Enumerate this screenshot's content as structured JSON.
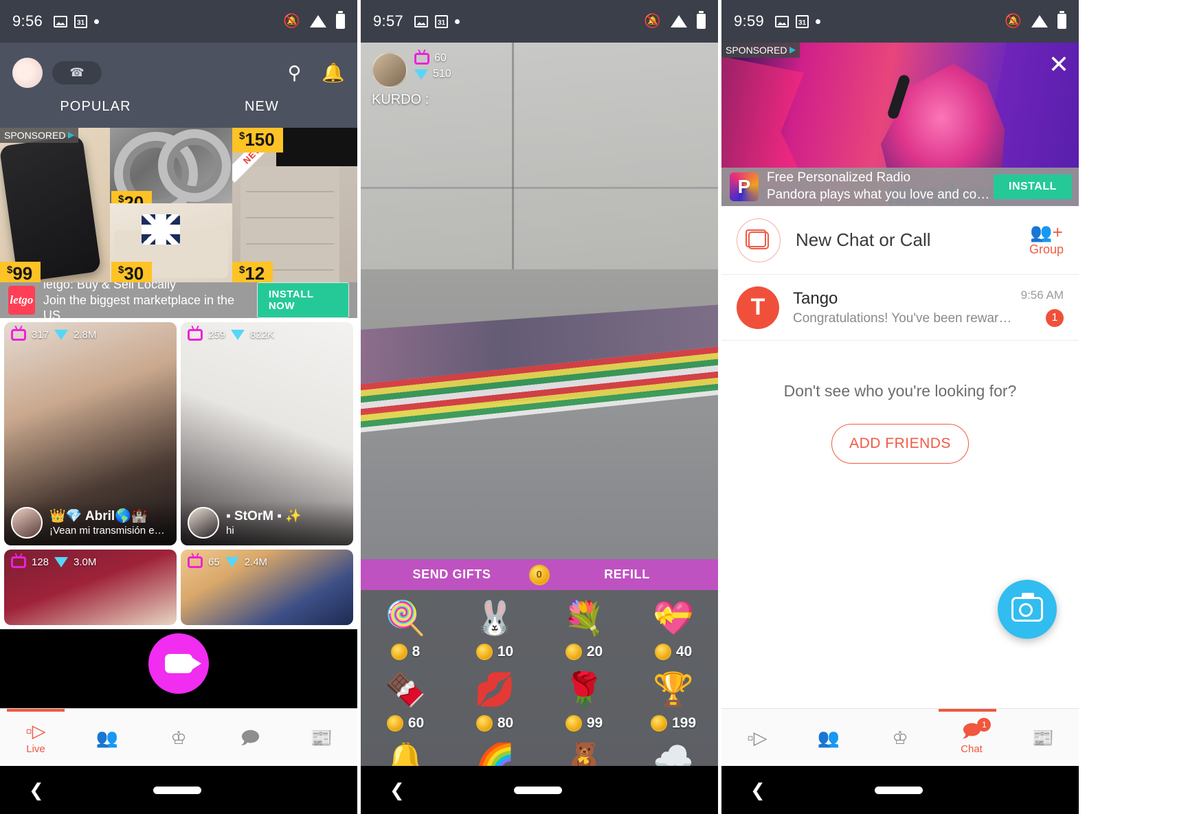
{
  "panels": [
    {
      "id": "discover",
      "status": {
        "time": "9:56",
        "icons_left": [
          "image-icon",
          "calendar-icon",
          "dot-icon"
        ],
        "icons_right": [
          "bell-muted-icon",
          "wifi-icon",
          "battery-icon"
        ]
      },
      "header": {
        "avatar": "user-avatar",
        "phone_icon": "phone-icon",
        "search_icon": "search-icon",
        "bell_icon": "bell-icon"
      },
      "tabs": [
        {
          "label": "POPULAR",
          "active": true
        },
        {
          "label": "NEW",
          "active": false
        }
      ],
      "sponsored_grid": {
        "badge": "SPONSORED",
        "ribbon": "NEW",
        "tiles": [
          {
            "currency": "$",
            "price": "99"
          },
          {
            "currency": "$",
            "price": "20"
          },
          {
            "currency": "$",
            "price": "30"
          },
          {
            "currency": "$",
            "price": "150"
          },
          {
            "currency": "$",
            "price": "12"
          }
        ]
      },
      "ad_banner": {
        "logo_text": "letgo",
        "title": "letgo: Buy & Sell Locally",
        "subtitle": "Join the biggest marketplace in the US. …",
        "cta": "INSTALL NOW"
      },
      "cards": [
        {
          "viewers": "317",
          "gems": "2.8M",
          "name": "👑💎 Abril🌎🏰",
          "sub": "¡Vean mi transmisión en vivo!"
        },
        {
          "viewers": "259",
          "gems": "822K",
          "name": "▪ StOrM ▪ ✨",
          "sub": "hi"
        },
        {
          "viewers": "128",
          "gems": "3.0M",
          "name": "",
          "sub": ""
        },
        {
          "viewers": "65",
          "gems": "2.4M",
          "name": "",
          "sub": ""
        }
      ],
      "fab": {
        "icon": "video-camera-icon"
      },
      "bottom_nav": [
        {
          "label": "Live",
          "icon": "live-video-icon",
          "active": true,
          "badge": ""
        },
        {
          "label": "",
          "icon": "people-icon",
          "active": false,
          "badge": ""
        },
        {
          "label": "",
          "icon": "crown-icon",
          "active": false,
          "badge": ""
        },
        {
          "label": "",
          "icon": "chat-icon",
          "active": false,
          "badge": ""
        },
        {
          "label": "",
          "icon": "news-icon",
          "active": false,
          "badge": ""
        }
      ],
      "system_nav": {
        "back": "back-icon",
        "home": "home-pill"
      }
    },
    {
      "id": "livestream",
      "status": {
        "time": "9:57",
        "icons_left": [
          "image-icon",
          "calendar-icon",
          "dot-icon"
        ],
        "icons_right": [
          "bell-muted-icon",
          "wifi-icon",
          "battery-icon"
        ]
      },
      "streamer": {
        "name": "KURDO :",
        "viewers": "60",
        "gems": "510",
        "avatar": "streamer-avatar"
      },
      "close_icon": "close-icon",
      "gift_bar": {
        "send_label": "SEND GIFTS",
        "balance": "0",
        "refill_label": "REFILL"
      },
      "gifts": [
        {
          "emoji": "🍭",
          "price": "8"
        },
        {
          "emoji": "🐰",
          "price": "10"
        },
        {
          "emoji": "💐",
          "price": "20"
        },
        {
          "emoji": "💝",
          "price": "40"
        },
        {
          "emoji": "🍫",
          "price": "60"
        },
        {
          "emoji": "💋",
          "price": "80"
        },
        {
          "emoji": "🌹",
          "price": "99"
        },
        {
          "emoji": "🏆",
          "price": "199"
        }
      ],
      "gifts_partial": [
        "🔔",
        "🌈",
        "🧸",
        "☁️"
      ],
      "system_nav": {
        "back": "back-icon",
        "home": "home-pill"
      }
    },
    {
      "id": "chat",
      "status": {
        "time": "9:59",
        "icons_left": [
          "image-icon",
          "calendar-icon",
          "dot-icon"
        ],
        "icons_right": [
          "bell-muted-icon",
          "wifi-icon",
          "battery-icon"
        ]
      },
      "ad": {
        "badge": "SPONSORED",
        "brand_watermark": "pandora",
        "close_icon": "close-icon",
        "title": "Free Personalized Radio",
        "subtitle": "Pandora plays what you love and conti…",
        "cta": "INSTALL"
      },
      "new_chat": {
        "label": "New Chat or Call",
        "icon": "new-chat-icon",
        "group_label": "Group",
        "group_icon": "add-group-icon"
      },
      "chats": [
        {
          "avatar_letter": "T",
          "name": "Tango",
          "preview": "Congratulations! You've been rewarded with 10 …",
          "time": "9:56 AM",
          "unread": "1"
        }
      ],
      "empty_prompt": "Don't see who you're looking for?",
      "add_friends_label": "ADD FRIENDS",
      "fab": {
        "icon": "video-camera-icon"
      },
      "bottom_nav": [
        {
          "label": "",
          "icon": "live-video-icon",
          "active": false,
          "badge": ""
        },
        {
          "label": "",
          "icon": "people-icon",
          "active": false,
          "badge": ""
        },
        {
          "label": "",
          "icon": "crown-icon",
          "active": false,
          "badge": ""
        },
        {
          "label": "Chat",
          "icon": "chat-icon",
          "active": true,
          "badge": "1"
        },
        {
          "label": "",
          "icon": "news-icon",
          "active": false,
          "badge": ""
        }
      ],
      "system_nav": {
        "back": "back-icon",
        "home": "home-pill"
      }
    }
  ],
  "colors": {
    "accent_red": "#ef5b43",
    "accent_pink": "#f02df0",
    "accent_green": "#25c998",
    "accent_blue": "#31bdef",
    "header_bg": "#4d5260",
    "statusbar_bg": "#3b3f4a",
    "price_yellow": "#ffc325"
  }
}
